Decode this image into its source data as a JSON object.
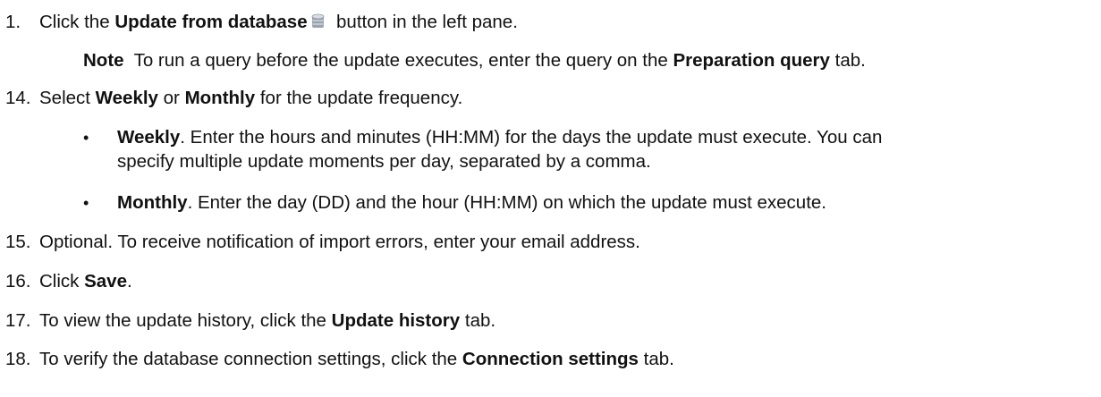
{
  "steps": [
    {
      "number": "1.",
      "pre": "Click the ",
      "bold": "Update from database",
      "post": "  button in the left pane.",
      "icon": "database-icon"
    },
    {
      "note_label": "Note",
      "note_pre": "  To run a query before the update executes, enter the query on the ",
      "note_bold": "Preparation query",
      "note_post": " tab."
    },
    {
      "number": "14.",
      "pre": "Select ",
      "bold1": "Weekly",
      "mid": " or ",
      "bold2": "Monthly",
      "post": " for the update frequency."
    },
    {
      "bullets": [
        {
          "bold": "Weekly",
          "line1": ". Enter the hours and minutes (HH:MM) for the days the update must execute. You can",
          "line2": "specify multiple update moments per day, separated by a comma."
        },
        {
          "bold": "Monthly",
          "line1": ". Enter the day (DD) and the hour (HH:MM) on which the update must execute."
        }
      ]
    },
    {
      "number": "15.",
      "text": "Optional. To receive notification of import errors, enter your email address."
    },
    {
      "number": "16.",
      "pre": "Click ",
      "bold": "Save",
      "post": "."
    },
    {
      "number": "17.",
      "pre": "To view the update history, click the ",
      "bold": "Update history",
      "post": " tab."
    },
    {
      "number": "18.",
      "pre": "To verify the database connection settings, click the ",
      "bold": "Connection settings",
      "post": " tab."
    }
  ],
  "colors": {
    "text": "#111111",
    "icon_body": "#9aa4b0",
    "icon_top": "#d7dde3"
  }
}
